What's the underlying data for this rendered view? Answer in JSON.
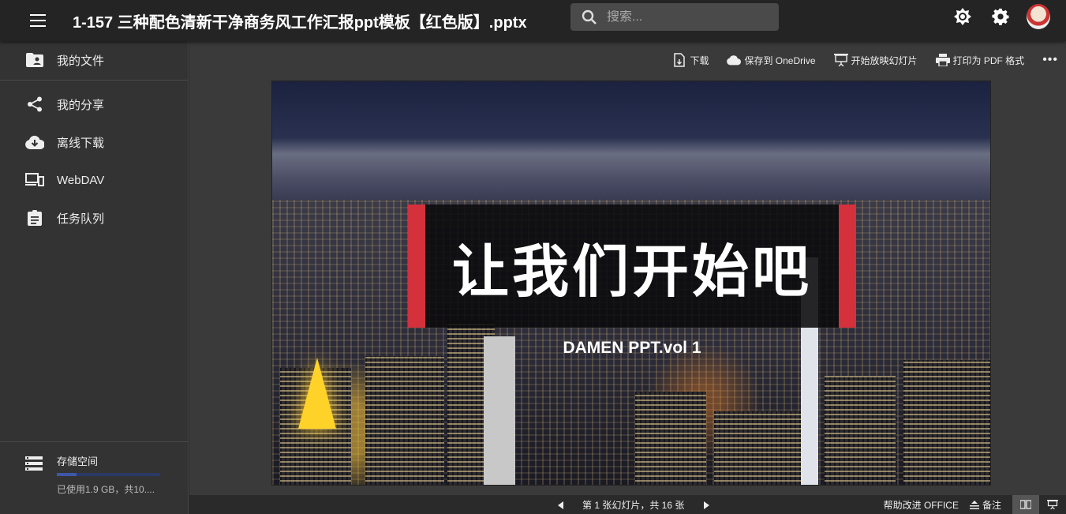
{
  "header": {
    "title": "1-157 三种配色清新干净商务风工作汇报ppt模板【红色版】.pptx",
    "search_placeholder": "搜索..."
  },
  "icons": {
    "menu": "menu-icon",
    "search": "search-icon",
    "theme": "brightness-icon",
    "settings": "gear-icon",
    "avatar": "avatar"
  },
  "sidebar": {
    "items": [
      {
        "label": "我的文件",
        "icon": "folder-account-icon"
      },
      {
        "label": "我的分享",
        "icon": "share-icon"
      },
      {
        "label": "离线下载",
        "icon": "cloud-download-icon"
      },
      {
        "label": "WebDAV",
        "icon": "devices-icon"
      },
      {
        "label": "任务队列",
        "icon": "clipboard-icon"
      }
    ],
    "storage": {
      "label": "存储空间",
      "usage_text": "已使用1.9 GB，共10....",
      "used_fraction": 0.19
    }
  },
  "toolbar": {
    "download": "下载",
    "save_onedrive": "保存到 OneDrive",
    "start_slideshow": "开始放映幻灯片",
    "print_pdf": "打印为 PDF 格式",
    "more": "•••"
  },
  "slide": {
    "title": "让我们开始吧",
    "subtitle": "DAMEN PPT.vol 1",
    "accent_color": "#d4313d"
  },
  "footer": {
    "page_info": "第 1 张幻灯片，共 16 张",
    "help": "帮助改进 OFFICE",
    "notes": "备注"
  }
}
